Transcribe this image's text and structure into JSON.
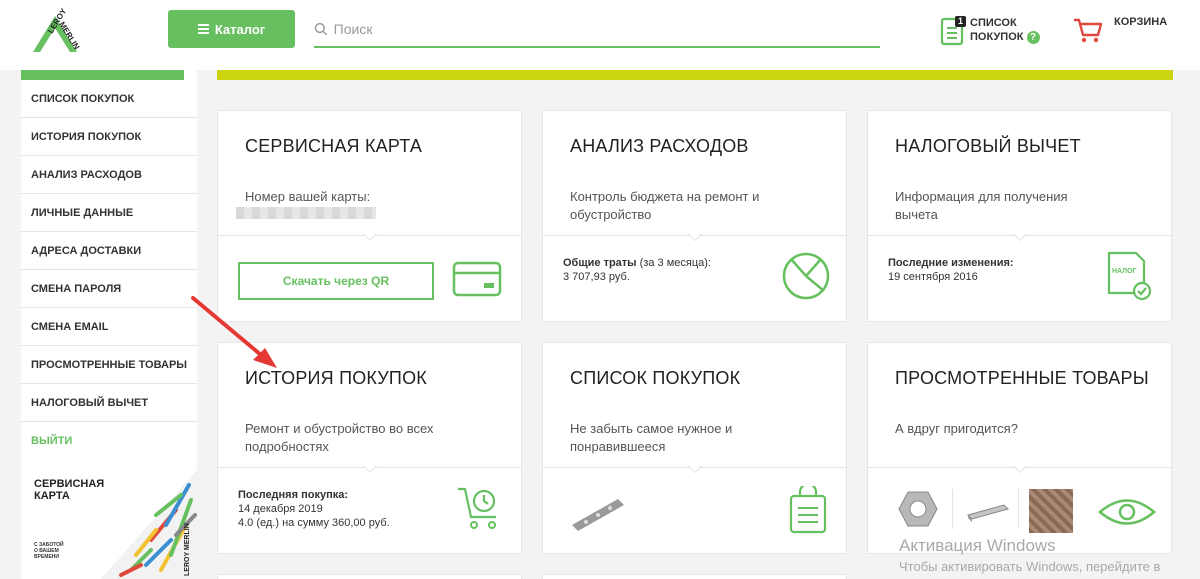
{
  "header": {
    "logo_text": "LEROY MERLIN",
    "catalog_label": "Каталог",
    "search_placeholder": "Поиск",
    "shoplist_count": "1",
    "shoplist_line1": "СПИСОК",
    "shoplist_line2": "ПОКУПОК",
    "shoplist_help": "?",
    "cart_label": "КОРЗИНА"
  },
  "sidebar": {
    "items": [
      {
        "label": "СПИСОК ПОКУПОК"
      },
      {
        "label": "ИСТОРИЯ ПОКУПОК"
      },
      {
        "label": "АНАЛИЗ РАСХОДОВ"
      },
      {
        "label": "ЛИЧНЫЕ ДАННЫЕ"
      },
      {
        "label": "АДРЕСА ДОСТАВКИ"
      },
      {
        "label": "СМЕНА ПАРОЛЯ"
      },
      {
        "label": "СМЕНА EMAIL"
      },
      {
        "label": "ПРОСМОТРЕННЫЕ ТОВАРЫ"
      },
      {
        "label": "НАЛОГОВЫЙ ВЫЧЕТ"
      }
    ],
    "logout": "ВЫЙТИ",
    "promo": {
      "line1": "СЕРВИСНАЯ",
      "line2": "КАРТА",
      "small1": "С ЗАБОТОЙ",
      "small2": "О ВАШЕМ",
      "small3": "ВРЕМЕНИ",
      "brand": "LEROY MERLIN"
    }
  },
  "cards": {
    "service_card": {
      "title": "СЕРВИСНАЯ КАРТА",
      "desc": "Номер вашей карты:",
      "button": "Скачать через QR"
    },
    "expense": {
      "title": "АНАЛИЗ РАСХОДОВ",
      "desc": "Контроль бюджета на ремонт и обустройство",
      "info_bold": "Общие траты",
      "info_suffix": " (за 3 месяца):",
      "info_value": "3 707,93 руб."
    },
    "tax": {
      "title": "НАЛОГОВЫЙ ВЫЧЕТ",
      "desc": "Информация для получения вычета",
      "info_bold": "Последние изменения:",
      "info_value": "19 сентября 2016",
      "icon_text": "НАЛОГ"
    },
    "history": {
      "title": "ИСТОРИЯ ПОКУПОК",
      "desc": "Ремонт и обустройство во всех подробностях",
      "info_bold": "Последняя покупка:",
      "info_line2": "14 декабря 2019",
      "info_line3": "4.0 (ед.) на сумму 360,00 руб."
    },
    "shoplist": {
      "title": "СПИСОК ПОКУПОК",
      "desc": "Не забыть самое нужное и понравившееся"
    },
    "viewed": {
      "title": "ПРОСМОТРЕННЫЕ ТОВАРЫ",
      "desc": "А вдруг пригодится?"
    }
  },
  "watermark": {
    "line1": "Активация Windows",
    "line2": "Чтобы активировать Windows, перейдите в"
  },
  "colors": {
    "green": "#66c05f",
    "accent_yellow": "#cbd40e",
    "arrow_red": "#e53935"
  }
}
